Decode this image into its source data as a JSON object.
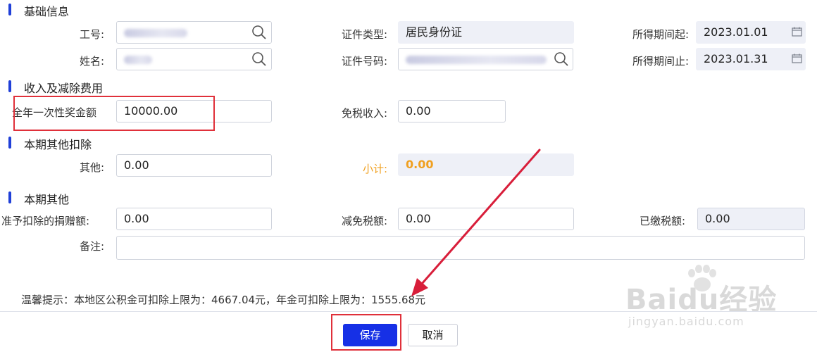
{
  "sections": {
    "basic": "基础信息",
    "income": "收入及减除费用",
    "deduction": "本期其他扣除",
    "other": "本期其他"
  },
  "basic": {
    "job_no_label": "工号:",
    "name_label": "姓名:",
    "id_type_label": "证件类型:",
    "id_type_value": "居民身份证",
    "id_no_label": "证件号码:",
    "period_start_label": "所得期间起:",
    "period_start_value": "2023.01.01",
    "period_end_label": "所得期间止:",
    "period_end_value": "2023.01.31"
  },
  "income": {
    "bonus_label": "全年一次性奖金额",
    "bonus_value": "10000.00",
    "exempt_label": "免税收入:",
    "exempt_value": "0.00"
  },
  "deduction": {
    "other_label": "其他:",
    "other_value": "0.00",
    "subtotal_label": "小计:",
    "subtotal_value": "0.00"
  },
  "other": {
    "donation_label": "准予扣除的捐赠额:",
    "donation_value": "0.00",
    "relief_label": "减免税额:",
    "relief_value": "0.00",
    "paid_label": "已缴税额:",
    "paid_value": "0.00",
    "remark_label": "备注:",
    "remark_value": ""
  },
  "hint": "温馨提示：本地区公积金可扣除上限为：4667.04元，年金可扣除上限为：1555.68元",
  "buttons": {
    "save": "保存",
    "cancel": "取消"
  },
  "watermark": {
    "logo": "Baidu经验",
    "url": "jingyan.baidu.com"
  },
  "colors": {
    "accent": "#1630e6",
    "highlight_border": "#e0303a",
    "subtotal_text": "#f0a020",
    "arrow": "#d81e3a"
  },
  "icons": [
    "search-icon",
    "calendar-icon"
  ]
}
